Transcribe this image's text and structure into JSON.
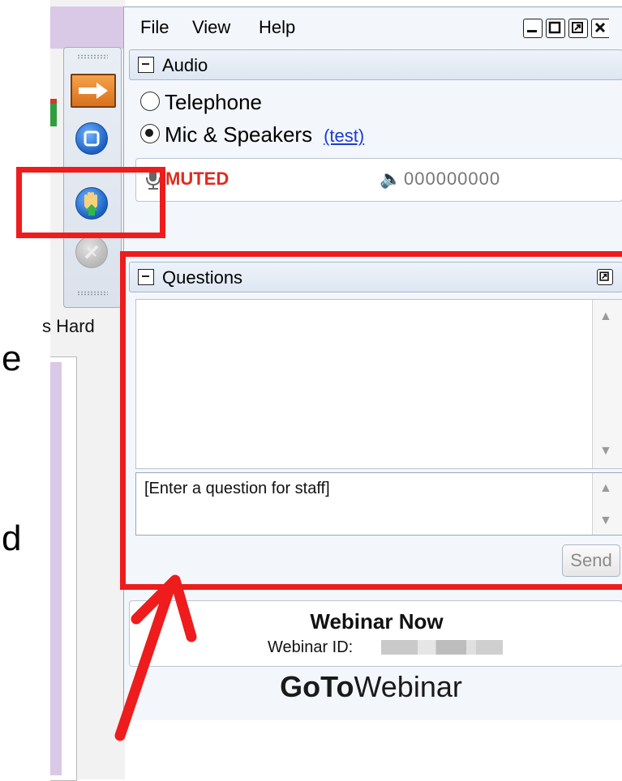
{
  "background": {
    "partial_text": "s Hard",
    "partial_letters": [
      "e",
      "d"
    ]
  },
  "menubar": {
    "items": [
      "File",
      "View",
      "Help"
    ]
  },
  "audio": {
    "header": "Audio",
    "options": [
      {
        "label": "Telephone",
        "selected": false
      },
      {
        "label": "Mic & Speakers",
        "selected": true
      }
    ],
    "test_link": "(test)",
    "status": "MUTED",
    "level": "000000000"
  },
  "questions": {
    "header": "Questions",
    "input_text": "[Enter a question for staff]",
    "send_label": "Send"
  },
  "webinar": {
    "title": "Webinar Now",
    "id_label": "Webinar ID:",
    "logo_bold": "GoTo",
    "logo_regular": "Webinar"
  },
  "colors": {
    "annotation_red": "#ee1c1c",
    "muted_red": "#e12a1c",
    "link_blue": "#1a3cd6"
  },
  "icons": [
    "arrow-right-icon",
    "stop-icon",
    "raise-hand-icon",
    "disabled-tool-icon",
    "microphone-icon",
    "speaker-icon",
    "minimize-icon",
    "maximize-icon",
    "popout-icon",
    "close-icon",
    "collapse-icon"
  ]
}
